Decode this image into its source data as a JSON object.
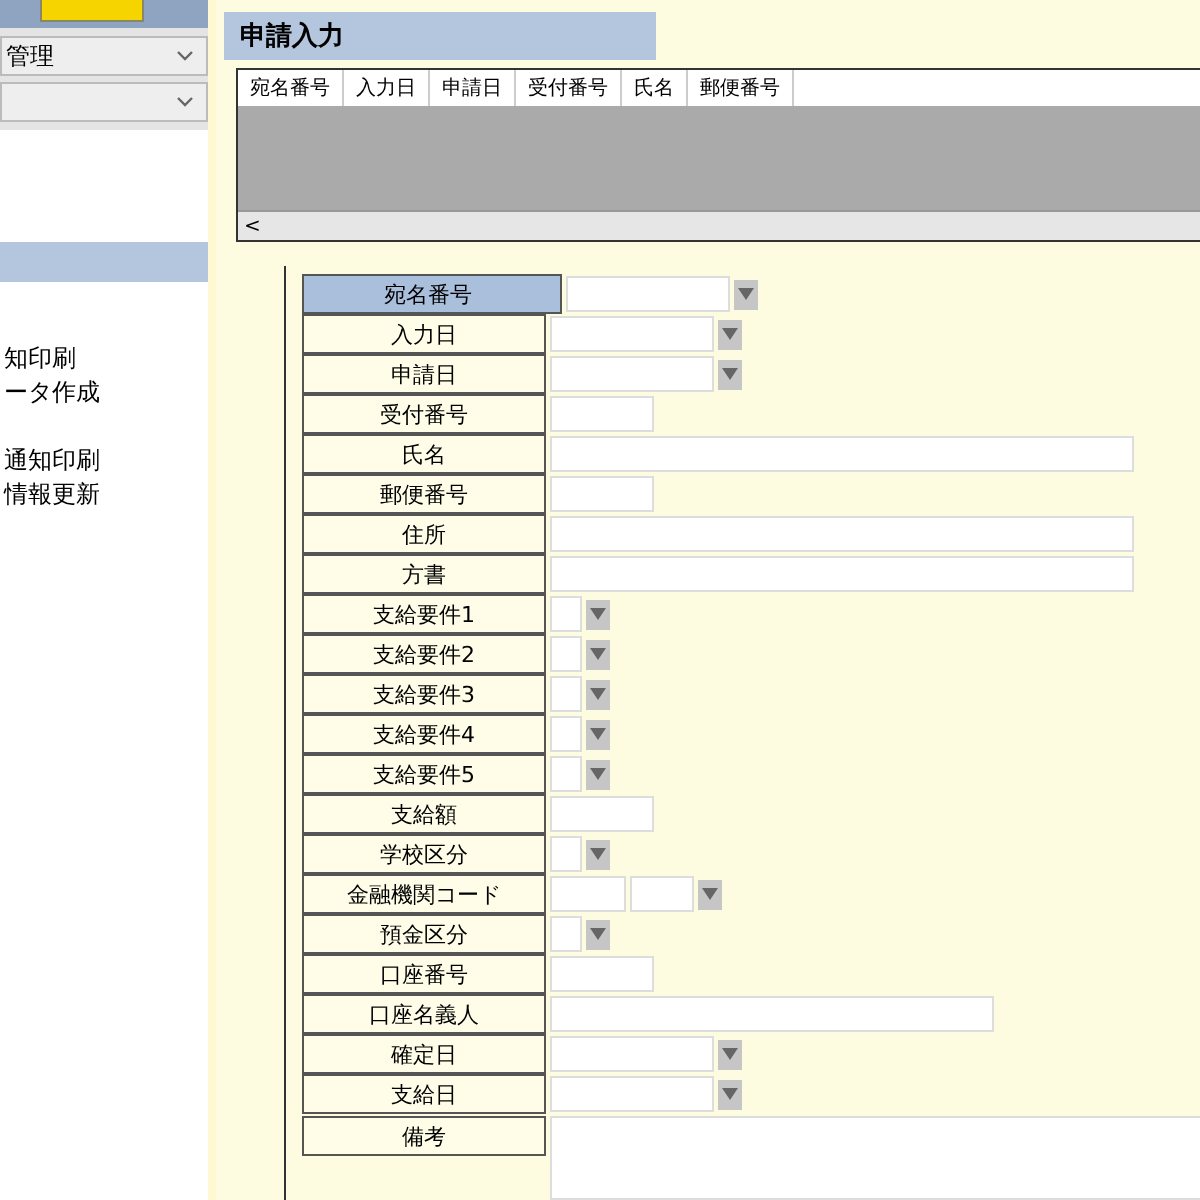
{
  "sidebar": {
    "selects": [
      {
        "kind": "dropdown",
        "value": "管理"
      },
      {
        "kind": "dropdown"
      }
    ],
    "menu_groups": [
      {
        "items": [
          "知印刷",
          "ータ作成"
        ]
      },
      {
        "items": [
          "通知印刷",
          "情報更新"
        ]
      }
    ]
  },
  "panel": {
    "title": "申請入力",
    "grid_columns": [
      "宛名番号",
      "入力日",
      "申請日",
      "受付番号",
      "氏名",
      "郵便番号"
    ],
    "scroll_left": "<",
    "fields": [
      {
        "label": "宛名番号",
        "kind": "combo",
        "selected": true
      },
      {
        "label": "入力日",
        "kind": "combo",
        "selected": false
      },
      {
        "label": "申請日",
        "kind": "combo",
        "selected": false
      },
      {
        "label": "受付番号",
        "kind": "short",
        "selected": false
      },
      {
        "label": "氏名",
        "kind": "wide",
        "selected": false
      },
      {
        "label": "郵便番号",
        "kind": "short",
        "selected": false
      },
      {
        "label": "住所",
        "kind": "wide",
        "selected": false
      },
      {
        "label": "方書",
        "kind": "wide",
        "selected": false
      },
      {
        "label": "支給要件1",
        "kind": "tiny",
        "selected": false
      },
      {
        "label": "支給要件2",
        "kind": "tiny",
        "selected": false
      },
      {
        "label": "支給要件3",
        "kind": "tiny",
        "selected": false
      },
      {
        "label": "支給要件4",
        "kind": "tiny",
        "selected": false
      },
      {
        "label": "支給要件5",
        "kind": "tiny",
        "selected": false
      },
      {
        "label": "支給額",
        "kind": "short",
        "selected": false
      },
      {
        "label": "学校区分",
        "kind": "tiny",
        "selected": false
      },
      {
        "label": "金融機関コード",
        "kind": "double",
        "selected": false
      },
      {
        "label": "預金区分",
        "kind": "tiny",
        "selected": false
      },
      {
        "label": "口座番号",
        "kind": "short",
        "selected": false
      },
      {
        "label": "口座名義人",
        "kind": "medium",
        "selected": false
      },
      {
        "label": "確定日",
        "kind": "combo",
        "selected": false
      },
      {
        "label": "支給日",
        "kind": "combo",
        "selected": false
      },
      {
        "label": "備考",
        "kind": "textarea",
        "selected": false
      }
    ]
  }
}
